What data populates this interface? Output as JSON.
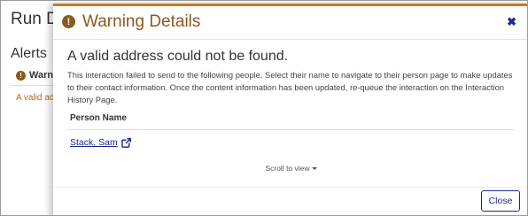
{
  "background": {
    "title": "Run D",
    "section": "Alerts",
    "warning_label": "Warnin",
    "message": "A valid ad",
    "icon": "exclamation-circle-icon"
  },
  "modal": {
    "title": "Warning Details",
    "title_icon": "exclamation-circle-icon",
    "close_icon": "close-icon",
    "heading": "A valid address could not be found.",
    "description": "This interaction failed to send to the following people. Select their name to navigate to their person page to make updates to their contact information. Once the content information has been updated, re-queue the interaction on the Interaction History Page.",
    "column_header": "Person Name",
    "people": [
      {
        "name": "Stack, Sam",
        "icon": "external-link-icon"
      }
    ],
    "scroll_hint": "Scroll to view",
    "close_button": "Close"
  },
  "colors": {
    "accent": "#c77a1b",
    "title": "#8a5a1c",
    "link": "#1b2a8c"
  }
}
